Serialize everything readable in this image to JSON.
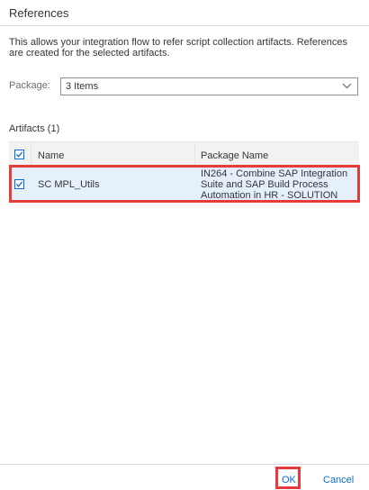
{
  "dialog": {
    "title": "References",
    "description": "This allows your integration flow to refer script collection artifacts. References are created for the selected artifacts."
  },
  "package": {
    "label": "Package:",
    "selected_value": "3 Items"
  },
  "artifacts": {
    "title": "Artifacts (1)",
    "columns": [
      "Name",
      "Package Name"
    ],
    "rows": [
      {
        "checked": true,
        "name": "SC MPL_Utils",
        "package_name": "IN264 - Combine SAP Integration Suite and SAP Build Process Automation in HR - SOLUTION"
      }
    ]
  },
  "footer": {
    "ok_label": "OK",
    "cancel_label": "Cancel"
  },
  "colors": {
    "accent": "#0a6ed1",
    "highlight_annotation": "#e63b3b",
    "selected_row": "#e5f0fa"
  }
}
